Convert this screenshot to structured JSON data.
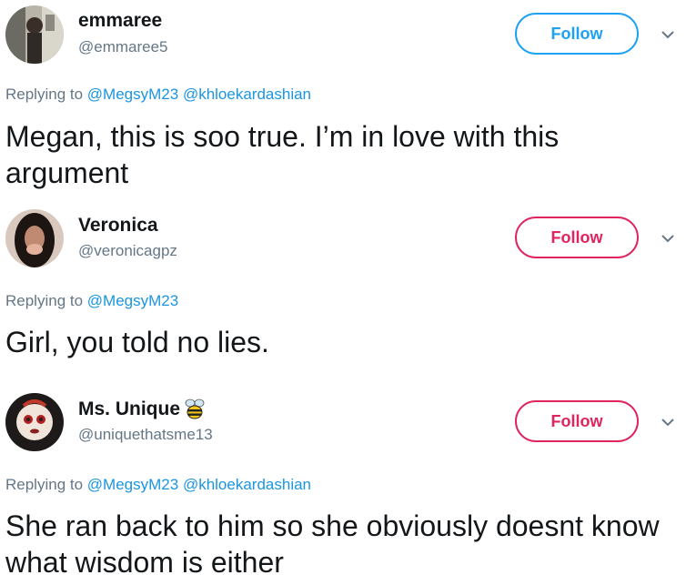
{
  "tweets": [
    {
      "name": "emmaree",
      "handle": "@emmaree5",
      "follow_label": "Follow",
      "follow_color": "#1da1f2",
      "replying_prefix": "Replying to",
      "mentions": [
        "@MegsyM23",
        "@khloekardashian"
      ],
      "text": "Megan, this is soo true. I’m in love with this argument"
    },
    {
      "name": "Veronica",
      "handle": "@veronicagpz",
      "follow_label": "Follow",
      "follow_color": "#e0245e",
      "replying_prefix": "Replying to",
      "mentions": [
        "@MegsyM23"
      ],
      "text": "Girl, you told no lies."
    },
    {
      "name": "Ms. Unique",
      "handle": "@uniquethatsme13",
      "follow_label": "Follow",
      "follow_color": "#e0245e",
      "replying_prefix": "Replying to",
      "mentions": [
        "@MegsyM23",
        "@khloekardashian"
      ],
      "text": "She ran back to him so she obviously doesnt know what wisdom is either",
      "name_emoji": "bee-icon"
    }
  ]
}
